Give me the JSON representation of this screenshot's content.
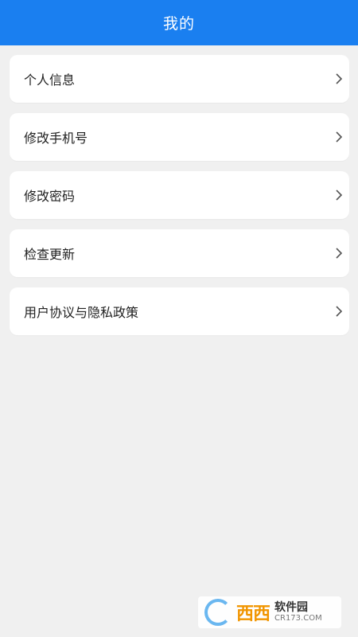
{
  "header": {
    "title": "我的"
  },
  "menu": {
    "items": [
      {
        "label": "个人信息",
        "icon": "chevron-right-icon"
      },
      {
        "label": "修改手机号",
        "icon": "chevron-right-icon"
      },
      {
        "label": "修改密码",
        "icon": "chevron-right-icon"
      },
      {
        "label": "检查更新",
        "icon": "chevron-right-icon"
      },
      {
        "label": "用户协议与隐私政策",
        "icon": "chevron-right-icon"
      }
    ]
  },
  "watermark": {
    "brand": "西西",
    "soft": "软件园",
    "site": "CR173.COM"
  },
  "colors": {
    "header_bg": "#1a7ff0",
    "page_bg": "#f0f0f0",
    "card_bg": "#ffffff"
  }
}
